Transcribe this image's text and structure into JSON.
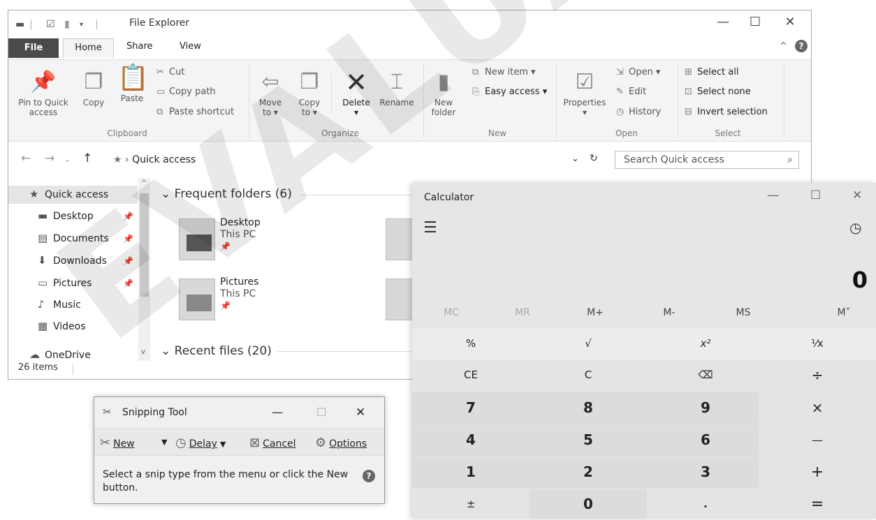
{
  "explorer": {
    "title": "File Explorer",
    "tabs": [
      "File",
      "Home",
      "Share",
      "View"
    ],
    "clipboard": {
      "pin": "Pin to Quick\naccess",
      "copy": "Copy",
      "paste": "Paste",
      "cut": "Cut",
      "copy_path": "Copy path",
      "paste_shortcut": "Paste shortcut",
      "group": "Clipboard"
    },
    "organize": {
      "move_to": "Move\nto ▾",
      "copy_to": "Copy\nto ▾",
      "delete": "Delete\n▾",
      "rename": "Rename",
      "group": "Organize"
    },
    "new": {
      "new_folder": "New\nfolder",
      "new_item": "New item ▾",
      "easy_access": "Easy access ▾",
      "group": "New"
    },
    "open": {
      "properties": "Properties\n▾",
      "open": "Open ▾",
      "edit": "Edit",
      "history": "History",
      "group": "Open"
    },
    "select": {
      "select_all": "Select all",
      "select_none": "Select none",
      "invert_selection": "Invert selection",
      "group": "Select"
    },
    "address": "Quick access",
    "search_placeholder": "Search Quick access",
    "sidebar": [
      {
        "label": "Quick access",
        "icon": "star-icon"
      },
      {
        "label": "Desktop",
        "icon": "desktop-icon"
      },
      {
        "label": "Documents",
        "icon": "document-icon"
      },
      {
        "label": "Downloads",
        "icon": "download-icon"
      },
      {
        "label": "Pictures",
        "icon": "pictures-icon"
      },
      {
        "label": "Music",
        "icon": "music-icon"
      },
      {
        "label": "Videos",
        "icon": "video-icon"
      },
      {
        "label": "OneDrive",
        "icon": "cloud-icon"
      }
    ],
    "frequent_header": "Frequent folders (6)",
    "recent_header": "Recent files (20)",
    "folders": [
      {
        "name": "Desktop",
        "location": "This PC"
      },
      {
        "name": "Pictures",
        "location": "This PC"
      }
    ],
    "status": "26 items"
  },
  "snipping": {
    "title": "Snipping Tool",
    "new": "New",
    "delay": "Delay",
    "cancel": "Cancel",
    "options": "Options",
    "message": "Select a snip type from the menu or click the New button."
  },
  "calculator": {
    "title": "Calculator",
    "display": "0",
    "memory": [
      "MC",
      "MR",
      "M+",
      "M-",
      "MS",
      "M˅"
    ],
    "keys": [
      [
        "%",
        "√",
        "x²",
        "¹⁄x"
      ],
      [
        "CE",
        "C",
        "⌫",
        "÷"
      ],
      [
        "7",
        "8",
        "9",
        "×"
      ],
      [
        "4",
        "5",
        "6",
        "—"
      ],
      [
        "1",
        "2",
        "3",
        "+"
      ],
      [
        "±",
        "0",
        ".",
        "="
      ]
    ]
  },
  "watermark": "EVALUATION"
}
